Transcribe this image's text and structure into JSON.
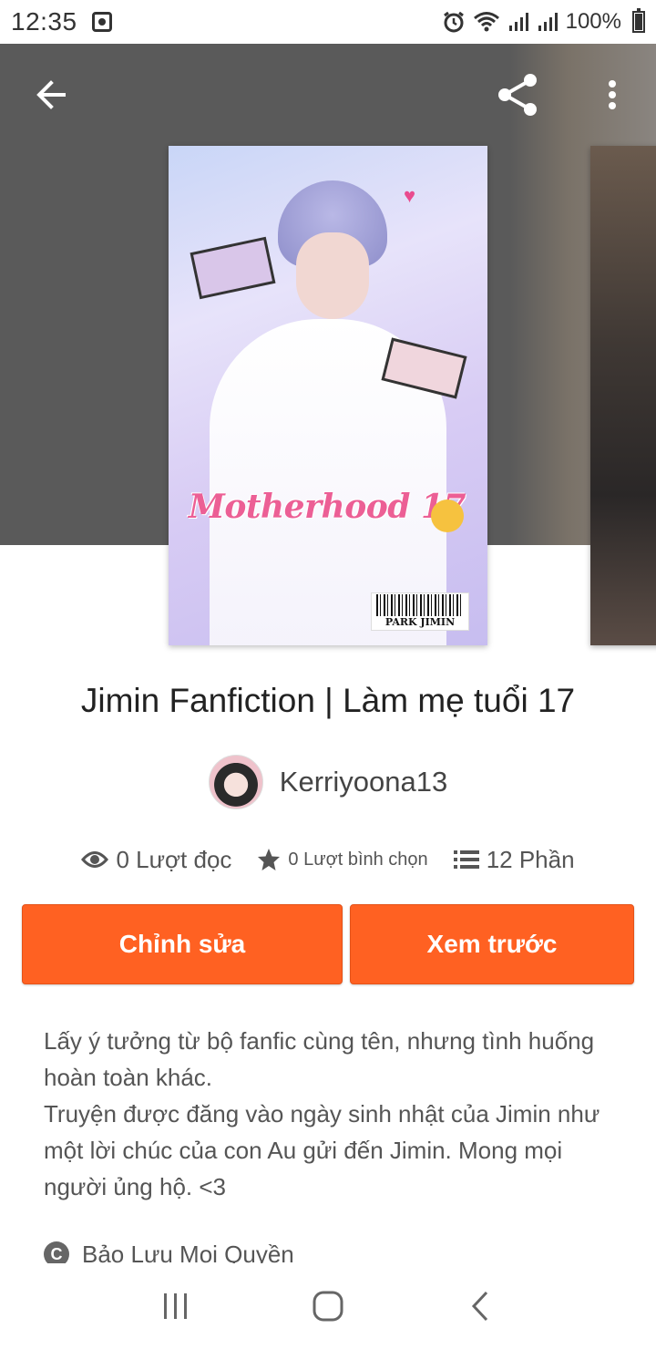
{
  "status_bar": {
    "time": "12:35",
    "battery": "100%"
  },
  "story": {
    "cover": {
      "title_text": "Motherhood 17",
      "barcode_text": "PARK JIMIN"
    },
    "title": "Jimin Fanfiction  | Làm mẹ tuổi 17",
    "author": "Kerriyoona13",
    "stats": {
      "reads": "0 Lượt đọc",
      "votes": "0 Lượt bình chọn",
      "parts": "12 Phần"
    },
    "description": [
      "Lấy ý tưởng từ bộ fanfic cùng tên, nhưng tình huống hoàn toàn khác.",
      "Truyện được đăng vào ngày sinh nhật của Jimin như một lời chúc của con Au gửi đến Jimin. Mong mọi người ủng hộ. <3"
    ],
    "copyright": "Bảo Lưu Mọi Quyền"
  },
  "actions": {
    "edit_label": "Chỉnh sửa",
    "preview_label": "Xem trước"
  },
  "colors": {
    "accent": "#ff6122",
    "header_band": "#5a5a5a"
  },
  "icons": {
    "back": "arrow-left-icon",
    "share": "share-icon",
    "more": "more-vert-icon",
    "reads": "eye-icon",
    "votes": "star-icon",
    "parts": "list-icon",
    "copyright": "copyright-icon",
    "nav_recent": "recent-apps-icon",
    "nav_home": "home-icon",
    "nav_back": "back-chevron-icon"
  }
}
